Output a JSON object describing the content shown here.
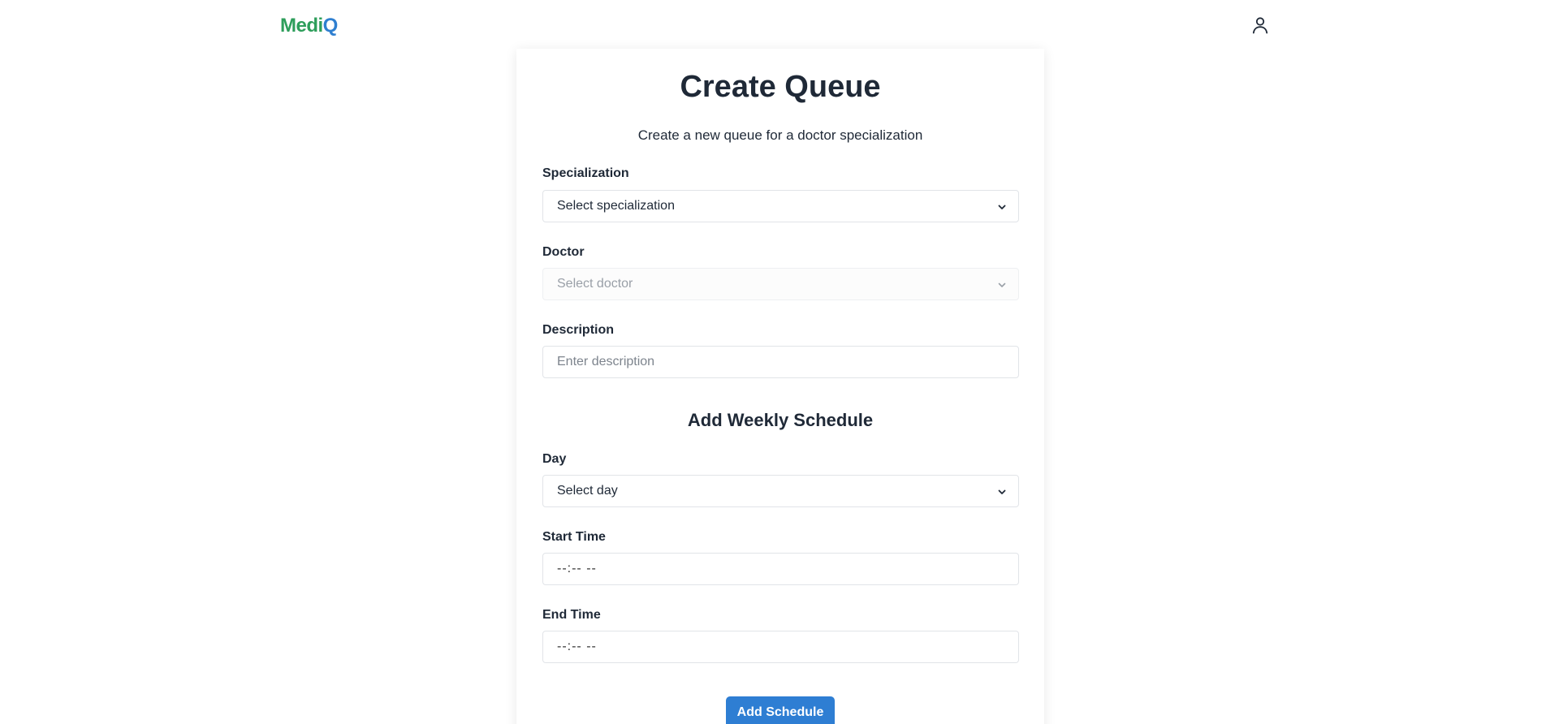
{
  "header": {
    "logo_part1": "Medi",
    "logo_part2": "Q",
    "user_icon": "user-icon"
  },
  "form": {
    "title": "Create Queue",
    "subtitle": "Create a new queue for a doctor specialization",
    "specialization": {
      "label": "Specialization",
      "selected": "Select specialization"
    },
    "doctor": {
      "label": "Doctor",
      "selected": "Select doctor"
    },
    "description": {
      "label": "Description",
      "placeholder": "Enter description"
    },
    "schedule_title": "Add Weekly Schedule",
    "day": {
      "label": "Day",
      "selected": "Select day"
    },
    "start_time": {
      "label": "Start Time",
      "value": "--:-- --"
    },
    "end_time": {
      "label": "End Time",
      "value": "--:-- --"
    },
    "add_schedule_button": "Add Schedule"
  },
  "colors": {
    "brand_green": "#2e9e5b",
    "brand_blue": "#2f7fd0",
    "button": "#2e7ed3",
    "text": "#1f2937"
  }
}
